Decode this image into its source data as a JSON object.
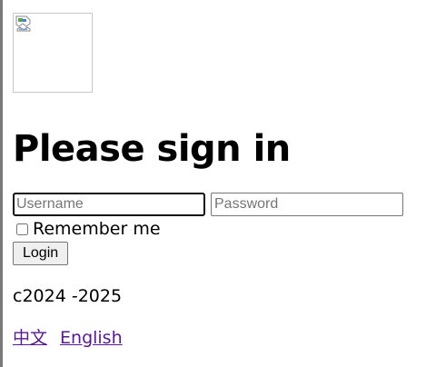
{
  "heading": "Please sign in",
  "form": {
    "username_placeholder": "Username",
    "username_value": "",
    "password_placeholder": "Password",
    "password_value": "",
    "remember_label": "Remember me",
    "remember_checked": false,
    "login_label": "Login"
  },
  "footer": {
    "copyright": "c2024 -2025",
    "languages": [
      {
        "label": "中文"
      },
      {
        "label": "English"
      }
    ]
  },
  "colors": {
    "link_visited": "#551a8b",
    "button_bg": "#efefef",
    "input_border": "#767676"
  },
  "icons": {
    "logo": "broken-image-icon"
  }
}
